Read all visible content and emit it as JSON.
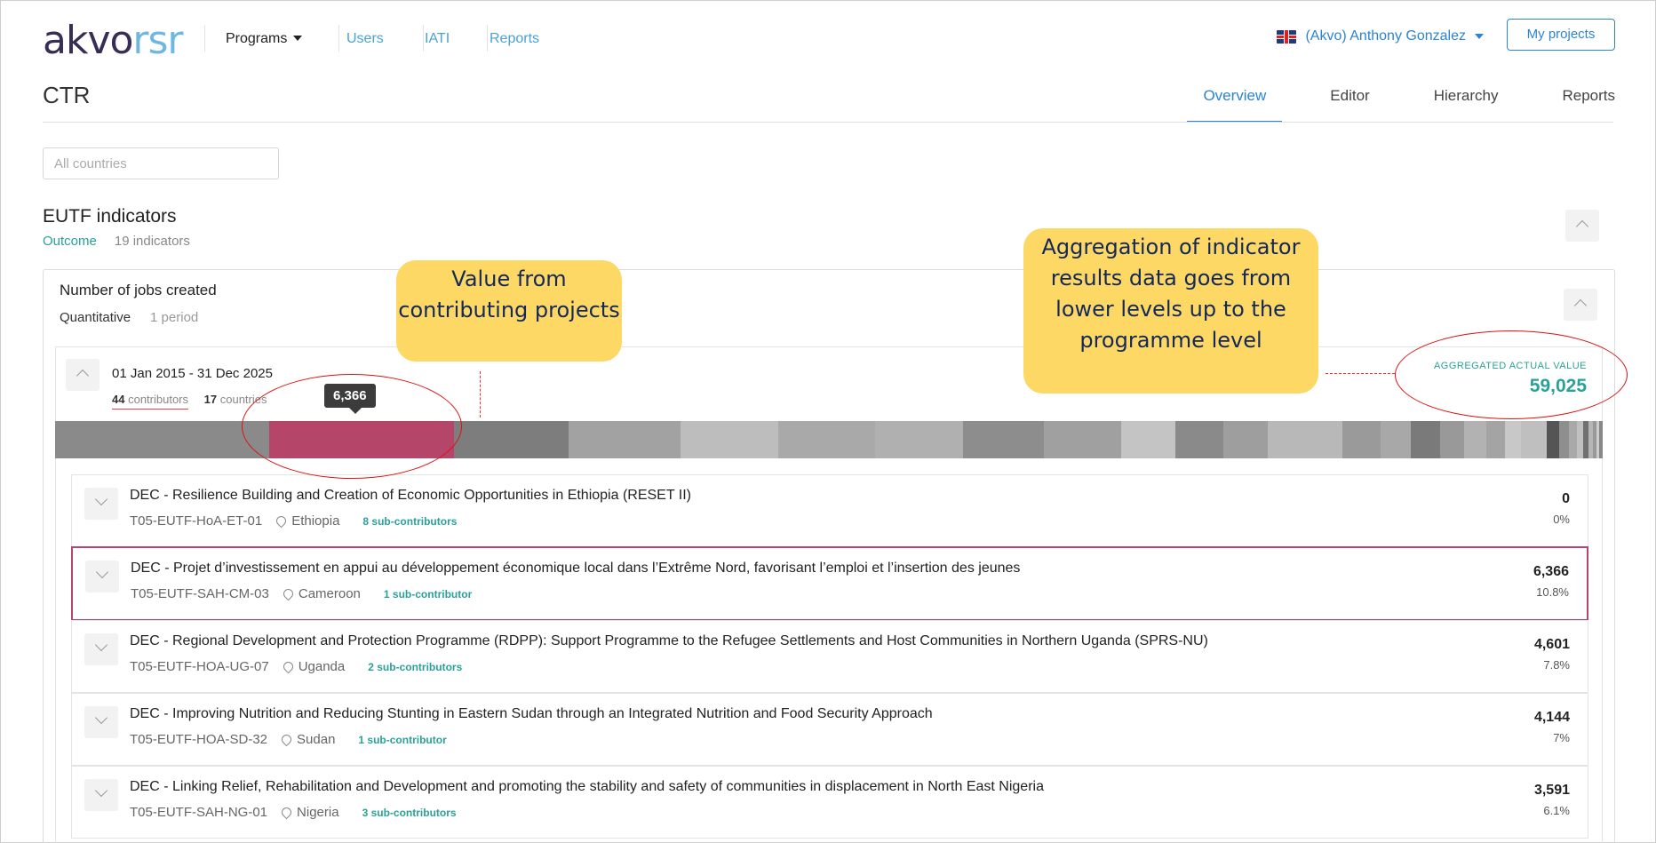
{
  "nav": {
    "logo_akvo": "akvo",
    "logo_rsr": "rsr",
    "programs_label": "Programs",
    "links": [
      "Users",
      "IATI",
      "Reports"
    ],
    "user_label": "(Akvo) Anthony Gonzalez",
    "my_projects_label": "My projects"
  },
  "header": {
    "title": "CTR",
    "tabs": [
      "Overview",
      "Editor",
      "Hierarchy",
      "Reports"
    ],
    "active_tab": "Overview"
  },
  "filter": {
    "countries_placeholder": "All countries"
  },
  "section": {
    "title": "EUTF indicators",
    "type": "Outcome",
    "count": "19 indicators"
  },
  "indicator": {
    "title": "Number of jobs created",
    "measure": "Quantitative",
    "periods": "1 period"
  },
  "period": {
    "range": "01 Jan 2015 - 31 Dec 2025",
    "contributors_count": "44",
    "contributors_label": "contributors",
    "countries_count": "17",
    "countries_label": "countries",
    "aggregated_label": "AGGREGATED ACTUAL VALUE",
    "aggregated_value": "59,025",
    "tooltip_value": "6,366"
  },
  "bar_segments": [
    {
      "share": 0.134,
      "color": "#8a8a8a"
    },
    {
      "share": 0.116,
      "color": "#b6456a"
    },
    {
      "share": 0.072,
      "color": "#7d7d7d"
    },
    {
      "share": 0.07,
      "color": "#a2a2a2"
    },
    {
      "share": 0.061,
      "color": "#bdbdbd"
    },
    {
      "share": 0.061,
      "color": "#a9a9a9"
    },
    {
      "share": 0.055,
      "color": "#b0b0b0"
    },
    {
      "share": 0.051,
      "color": "#8d8d8d"
    },
    {
      "share": 0.048,
      "color": "#a0a0a0"
    },
    {
      "share": 0.034,
      "color": "#c4c4c4"
    },
    {
      "share": 0.03,
      "color": "#8a8a8a"
    },
    {
      "share": 0.028,
      "color": "#9e9e9e"
    },
    {
      "share": 0.047,
      "color": "#b8b8b8"
    },
    {
      "share": 0.024,
      "color": "#9a9a9a"
    },
    {
      "share": 0.019,
      "color": "#a8a8a8"
    },
    {
      "share": 0.018,
      "color": "#7a7a7a"
    },
    {
      "share": 0.015,
      "color": "#999999"
    },
    {
      "share": 0.014,
      "color": "#b2b2b2"
    },
    {
      "share": 0.012,
      "color": "#a4a4a4"
    },
    {
      "share": 0.01,
      "color": "#c8c8c8"
    },
    {
      "share": 0.016,
      "color": "#bfbfbf"
    },
    {
      "share": 0.008,
      "color": "#555555"
    },
    {
      "share": 0.006,
      "color": "#8e8e8e"
    },
    {
      "share": 0.005,
      "color": "#a9a9a9"
    },
    {
      "share": 0.004,
      "color": "#c0c0c0"
    },
    {
      "share": 0.003,
      "color": "#707070"
    },
    {
      "share": 0.003,
      "color": "#b5b5b5"
    },
    {
      "share": 0.002,
      "color": "#999999"
    },
    {
      "share": 0.002,
      "color": "#cccccc"
    },
    {
      "share": 0.002,
      "color": "#888888"
    }
  ],
  "contributors": [
    {
      "title": "DEC - Resilience Building and Creation of Economic Opportunities in Ethiopia (RESET II)",
      "code": "T05-EUTF-HoA-ET-01",
      "country": "Ethiopia",
      "sub": "8 sub-contributors",
      "value": "0",
      "pct": "0%",
      "highlight": false
    },
    {
      "title": "DEC - Projet d’investissement en appui au développement économique local dans l’Extrême Nord, favorisant l’emploi et l’insertion des jeunes",
      "code": "T05-EUTF-SAH-CM-03",
      "country": "Cameroon",
      "sub": "1 sub-contributor",
      "value": "6,366",
      "pct": "10.8%",
      "highlight": true
    },
    {
      "title": "DEC - Regional Development and Protection Programme (RDPP): Support Programme to the Refugee Settlements and Host Communities in Northern Uganda (SPRS-NU)",
      "code": "T05-EUTF-HOA-UG-07",
      "country": "Uganda",
      "sub": "2 sub-contributors",
      "value": "4,601",
      "pct": "7.8%",
      "highlight": false
    },
    {
      "title": "DEC - Improving Nutrition and Reducing Stunting in Eastern Sudan through an Integrated Nutrition and Food Security Approach",
      "code": "T05-EUTF-HOA-SD-32",
      "country": "Sudan",
      "sub": "1 sub-contributor",
      "value": "4,144",
      "pct": "7%",
      "highlight": false
    },
    {
      "title": "DEC - Linking Relief, Rehabilitation and Development and promoting the stability and safety of communities in displacement in North East Nigeria",
      "code": "T05-EUTF-SAH-NG-01",
      "country": "Nigeria",
      "sub": "3 sub-contributors",
      "value": "3,591",
      "pct": "6.1%",
      "highlight": false
    }
  ],
  "annotations": {
    "left": "Value from contributing projects",
    "right": "Aggregation of indicator results data goes from lower levels up to the programme level"
  }
}
